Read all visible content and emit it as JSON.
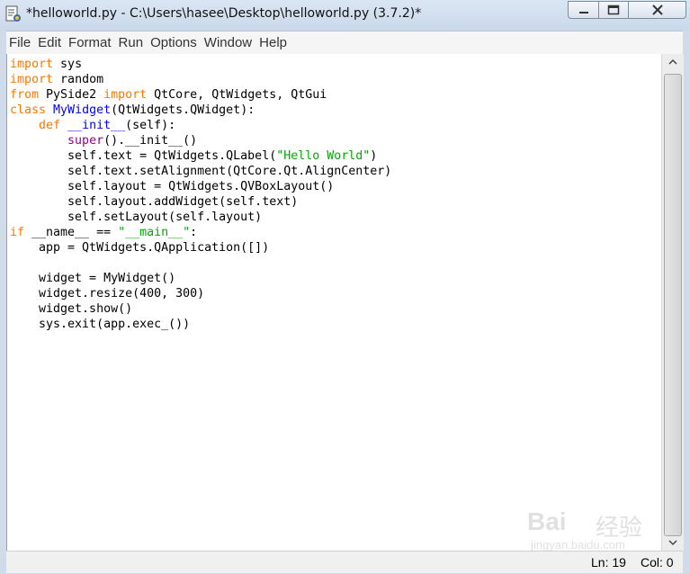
{
  "window": {
    "title": "*helloworld.py - C:\\Users\\hasee\\Desktop\\helloworld.py (3.7.2)*"
  },
  "menu": [
    "File",
    "Edit",
    "Format",
    "Run",
    "Options",
    "Window",
    "Help"
  ],
  "code_lines": [
    [
      {
        "t": "import",
        "c": "kw"
      },
      {
        "t": " sys"
      }
    ],
    [
      {
        "t": "import",
        "c": "kw"
      },
      {
        "t": " random"
      }
    ],
    [
      {
        "t": "from",
        "c": "kw"
      },
      {
        "t": " PySide2 "
      },
      {
        "t": "import",
        "c": "kw"
      },
      {
        "t": " QtCore, QtWidgets, QtGui"
      }
    ],
    [
      {
        "t": "class",
        "c": "kw"
      },
      {
        "t": " "
      },
      {
        "t": "MyWidget",
        "c": "def"
      },
      {
        "t": "(QtWidgets.QWidget):"
      }
    ],
    [
      {
        "t": "    "
      },
      {
        "t": "def",
        "c": "kw"
      },
      {
        "t": " "
      },
      {
        "t": "__init__",
        "c": "def"
      },
      {
        "t": "(self):"
      }
    ],
    [
      {
        "t": "        "
      },
      {
        "t": "super",
        "c": "bi"
      },
      {
        "t": "().__init__()"
      }
    ],
    [
      {
        "t": "        self.text = QtWidgets.QLabel("
      },
      {
        "t": "\"Hello World\"",
        "c": "str"
      },
      {
        "t": ")"
      }
    ],
    [
      {
        "t": "        self.text.setAlignment(QtCore.Qt.AlignCenter)"
      }
    ],
    [
      {
        "t": "        self.layout = QtWidgets.QVBoxLayout()"
      }
    ],
    [
      {
        "t": "        self.layout.addWidget(self.text)"
      }
    ],
    [
      {
        "t": "        self.setLayout(self.layout)"
      }
    ],
    [
      {
        "t": "if",
        "c": "kw"
      },
      {
        "t": " __name__ == "
      },
      {
        "t": "\"__main__\"",
        "c": "str"
      },
      {
        "t": ":"
      }
    ],
    [
      {
        "t": "    app = QtWidgets.QApplication([])"
      }
    ],
    [
      {
        "t": ""
      }
    ],
    [
      {
        "t": "    widget = MyWidget()"
      }
    ],
    [
      {
        "t": "    widget.resize(400, 300)"
      }
    ],
    [
      {
        "t": "    widget.show()"
      }
    ],
    [
      {
        "t": "    sys.exit(app.exec_())"
      }
    ]
  ],
  "status": {
    "line": "Ln: 19",
    "col": "Col: 0"
  },
  "watermark": {
    "brand": "Bai",
    "cn": "经验",
    "url": "jingyan.baidu.com"
  }
}
